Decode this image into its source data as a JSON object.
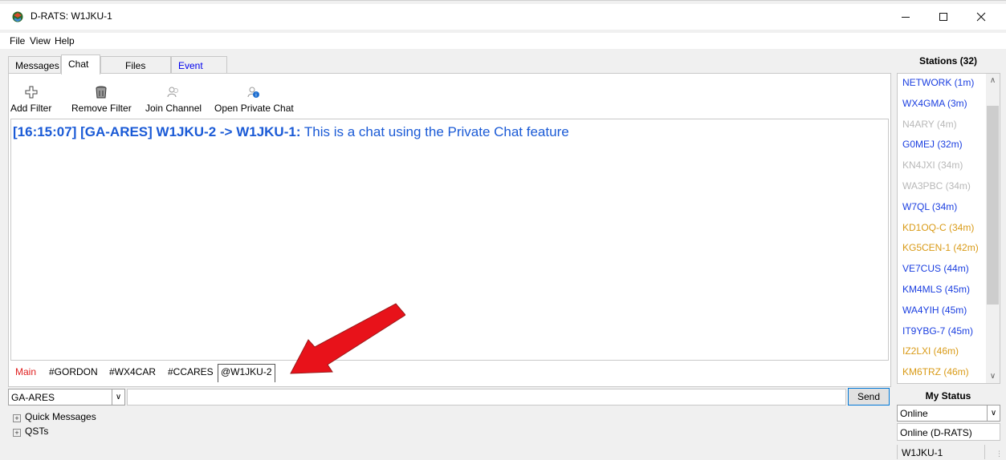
{
  "window": {
    "title": "D-RATS: W1JKU-1"
  },
  "menu": {
    "file": "File",
    "view": "View",
    "help": "Help"
  },
  "tabs": {
    "messages": "Messages",
    "chat": "Chat",
    "files": "Files",
    "event_log": "Event Log"
  },
  "toolbar": {
    "add_filter": "Add Filter",
    "remove_filter": "Remove Filter",
    "join_channel": "Join Channel",
    "open_private_chat": "Open Private Chat"
  },
  "chat": {
    "lines": [
      {
        "prefix": "[16:15:07] [GA-ARES] W1JKU-2 -> W1JKU-1:",
        "text": " This is a chat using the Private Chat feature"
      }
    ]
  },
  "channels": [
    "Main",
    "#GORDON",
    "#WX4CAR",
    "#CCARES",
    "@W1JKU-2"
  ],
  "input": {
    "channel_selected": "GA-ARES",
    "message_value": "",
    "send_label": "Send"
  },
  "expanders": {
    "quick_messages": "Quick Messages",
    "qsts": "QSTs"
  },
  "stations": {
    "header": "Stations (32)",
    "items": [
      {
        "label": "NETWORK (1m)",
        "color": "#1a3ee0"
      },
      {
        "label": "WX4GMA (3m)",
        "color": "#1a3ee0"
      },
      {
        "label": "N4ARY (4m)",
        "color": "#b8b8b8"
      },
      {
        "label": "G0MEJ (32m)",
        "color": "#1a3ee0"
      },
      {
        "label": "KN4JXI (34m)",
        "color": "#b8b8b8"
      },
      {
        "label": "WA3PBC (34m)",
        "color": "#b8b8b8"
      },
      {
        "label": "W7QL (34m)",
        "color": "#1a3ee0"
      },
      {
        "label": "KD1OQ-C (34m)",
        "color": "#d99a16"
      },
      {
        "label": "KG5CEN-1 (42m)",
        "color": "#d99a16"
      },
      {
        "label": "VE7CUS (44m)",
        "color": "#1a3ee0"
      },
      {
        "label": "KM4MLS (45m)",
        "color": "#1a3ee0"
      },
      {
        "label": "WA4YIH (45m)",
        "color": "#1a3ee0"
      },
      {
        "label": "IT9YBG-7 (45m)",
        "color": "#1a3ee0"
      },
      {
        "label": "IZ2LXI (46m)",
        "color": "#d99a16"
      },
      {
        "label": "KM6TRZ (46m)",
        "color": "#d99a16"
      }
    ]
  },
  "my_status": {
    "header": "My Status",
    "selected": "Online",
    "message": "Online (D-RATS)"
  },
  "statusbar": {
    "callsign": "W1JKU-1"
  },
  "colors": {
    "chat_text": "#1a5ad6",
    "main_channel": "#e02020",
    "annotation_arrow": "#e8121a",
    "send_border": "#0078d7"
  }
}
